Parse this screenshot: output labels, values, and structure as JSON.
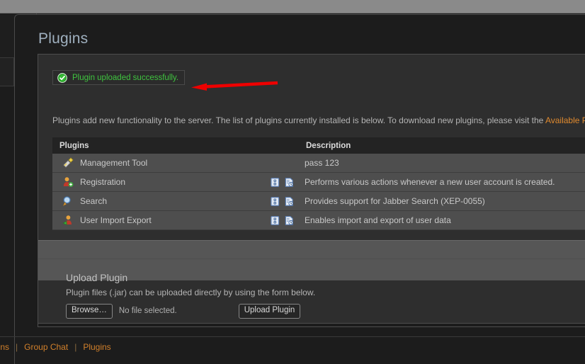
{
  "page": {
    "title": "Plugins"
  },
  "alert": {
    "icon": "success-check-icon",
    "message": "Plugin uploaded successfully."
  },
  "annotation": {
    "type": "arrow",
    "color": "#ee0000",
    "direction": "left"
  },
  "intro": {
    "text_before": "Plugins add new functionality to the server. The list of plugins currently installed is below. To download new plugins, please visit the ",
    "link_label": "Available P"
  },
  "table": {
    "headers": [
      "Plugins",
      "",
      "Description"
    ],
    "rows": [
      {
        "icon": "wrench-tool-icon",
        "name": "Management Tool",
        "actions": [],
        "description": "pass 123"
      },
      {
        "icon": "user-add-icon",
        "name": "Registration",
        "actions": [
          "info-document-icon",
          "changelog-document-icon"
        ],
        "description": "Performs various actions whenever a new user account is created."
      },
      {
        "icon": "magnifier-icon",
        "name": "Search",
        "actions": [
          "info-document-icon",
          "changelog-document-icon"
        ],
        "description": "Provides support for Jabber Search (XEP-0055)"
      },
      {
        "icon": "user-export-icon",
        "name": "User Import Export",
        "actions": [
          "info-document-icon",
          "changelog-document-icon"
        ],
        "description": "Enables import and export of user data"
      }
    ]
  },
  "upload": {
    "heading": "Upload Plugin",
    "description": "Plugin files (.jar) can be uploaded directly by using the form below.",
    "browse_label": "Browse…",
    "file_status": "No file selected.",
    "submit_label": "Upload Plugin"
  },
  "footer": {
    "links": [
      "sions",
      "Group Chat",
      "Plugins"
    ],
    "separator": "|"
  },
  "colors": {
    "accent_link": "#d2802b",
    "success_text": "#3fc43f",
    "panel_bg": "#2e2e2e",
    "row_bg": "#4e4e4e",
    "header_bg": "#232323",
    "annotation": "#ee0000"
  }
}
